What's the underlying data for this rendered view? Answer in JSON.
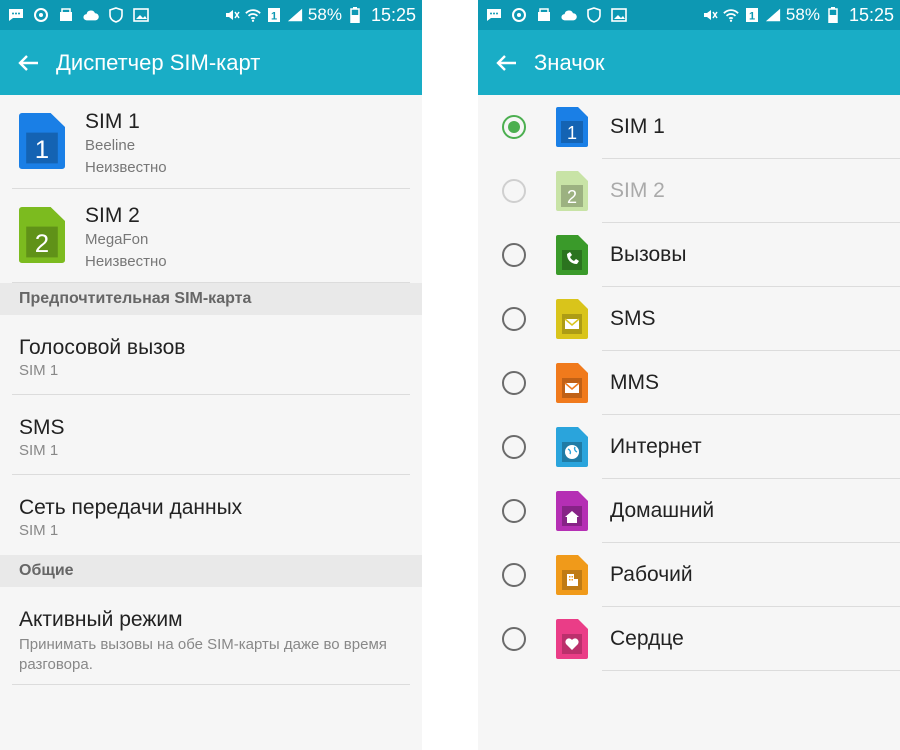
{
  "status": {
    "battery": "58%",
    "time": "15:25",
    "sim_badge": "1",
    "left_icons": [
      "chat-icon",
      "sync-icon",
      "usb-icon",
      "cloud-icon",
      "shield-icon",
      "image-icon"
    ],
    "right_icons": [
      "mute-icon",
      "wifi-icon",
      "sim-signal-icon",
      "signal-icon",
      "battery-icon"
    ]
  },
  "left": {
    "title": "Диспетчер SIM-карт",
    "sims": [
      {
        "name": "SIM 1",
        "operator": "Beeline",
        "status": "Неизвестно",
        "number": "1",
        "color": "#1a7fe6"
      },
      {
        "name": "SIM 2",
        "operator": "MegaFon",
        "status": "Неизвестно",
        "number": "2",
        "color": "#7cbb1f"
      }
    ],
    "section_preferred": "Предпочтительная SIM-карта",
    "preferred": [
      {
        "title": "Голосовой вызов",
        "value": "SIM 1"
      },
      {
        "title": "SMS",
        "value": "SIM 1"
      },
      {
        "title": "Сеть передачи данных",
        "value": "SIM 1"
      }
    ],
    "section_general": "Общие",
    "active_mode": {
      "title": "Активный режим",
      "desc": "Принимать вызовы на обе SIM-карты даже во время разговора."
    }
  },
  "right": {
    "title": "Значок",
    "options": [
      {
        "label": "SIM 1",
        "icon": "sim1-icon",
        "color": "#1a7fe6",
        "glyph": "1",
        "state": "checked"
      },
      {
        "label": "SIM 2",
        "icon": "sim2-icon",
        "color": "#c8e3a6",
        "glyph": "2",
        "state": "disabled"
      },
      {
        "label": "Вызовы",
        "icon": "phone-icon",
        "color": "#3a9a2a",
        "glyph": "phone",
        "state": "normal"
      },
      {
        "label": "SMS",
        "icon": "sms-envelope-icon",
        "color": "#d9c41b",
        "glyph": "mail",
        "state": "normal"
      },
      {
        "label": "MMS",
        "icon": "mms-envelope-icon",
        "color": "#f07a1c",
        "glyph": "mail",
        "state": "normal"
      },
      {
        "label": "Интернет",
        "icon": "globe-icon",
        "color": "#2aa4dc",
        "glyph": "globe",
        "state": "normal"
      },
      {
        "label": "Домашний",
        "icon": "home-icon",
        "color": "#b52fb4",
        "glyph": "home",
        "state": "normal"
      },
      {
        "label": "Рабочий",
        "icon": "building-icon",
        "color": "#f09a1a",
        "glyph": "building",
        "state": "normal"
      },
      {
        "label": "Сердце",
        "icon": "heart-icon",
        "color": "#ea3d87",
        "glyph": "heart",
        "state": "normal"
      }
    ]
  }
}
